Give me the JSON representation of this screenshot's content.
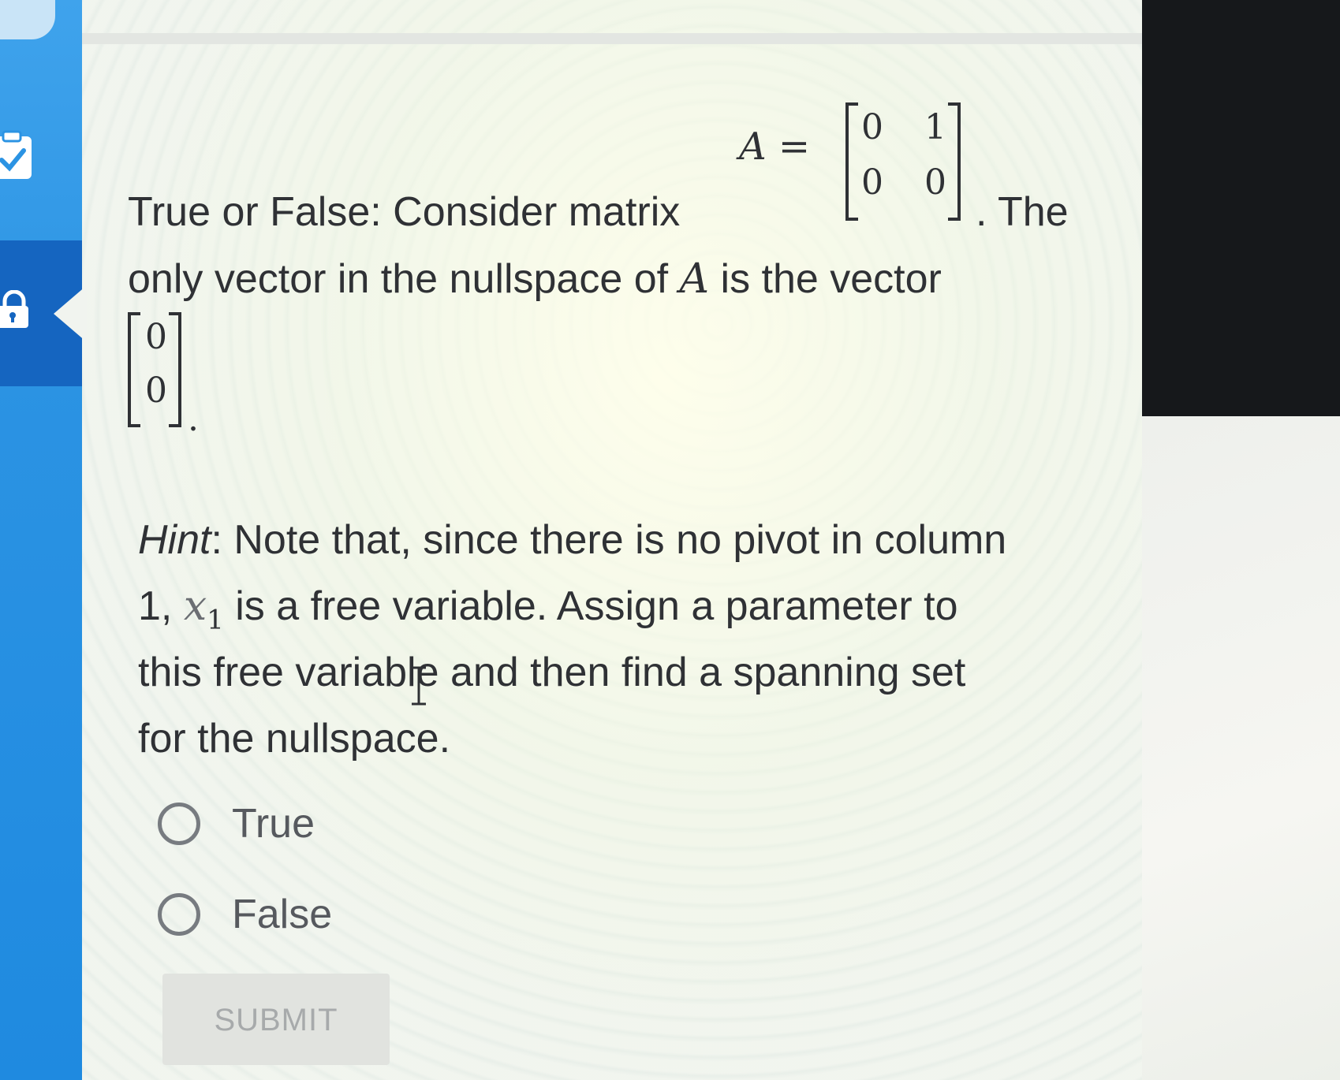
{
  "question": {
    "line1_text": "True or False: Consider matrix",
    "matrix_label": "A =",
    "matrix": [
      [
        "0",
        "1"
      ],
      [
        "0",
        "0"
      ]
    ],
    "line1_end": ". The",
    "line2_pre": "only vector in the nullspace of ",
    "line2_var": "A",
    "line2_post": " is the vector",
    "vector": [
      "0",
      "0"
    ],
    "vector_end": "."
  },
  "hint": {
    "label": "Hint",
    "line1_rest": ": Note that, since there is no pivot in column",
    "line2_pre": "1, ",
    "line2_var": "x",
    "line2_sub": "1",
    "line2_post": " is a free variable. Assign a parameter to",
    "line3": "this free variable and then find a spanning set",
    "line4": "for the nullspace."
  },
  "options": [
    {
      "label": "True",
      "selected": false
    },
    {
      "label": "False",
      "selected": false
    }
  ],
  "submit": {
    "label": "SUBMIT",
    "enabled": false
  },
  "colors": {
    "rail_blue": "#2b93e3",
    "rail_active": "#1565c0",
    "text": "#2f3135"
  },
  "icons": {
    "rail_top": "clipboard-check-icon",
    "rail_active": "lock-icon"
  }
}
